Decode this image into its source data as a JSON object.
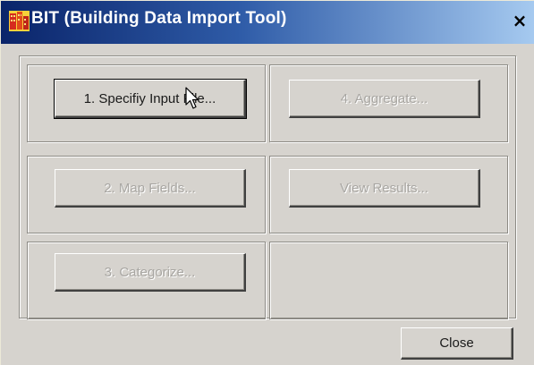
{
  "window": {
    "title": "BIT (Building Data Import Tool)",
    "close_glyph": "×",
    "app_icon": "bit-app-icon",
    "titlebar_colors": [
      "#0a246a",
      "#a6caf0"
    ]
  },
  "buttons": {
    "specify_input": {
      "label": "1. Specifiy Input File...",
      "enabled": true
    },
    "aggregate": {
      "label": "4. Aggregate...",
      "enabled": false
    },
    "map_fields": {
      "label": "2. Map Fields...",
      "enabled": false
    },
    "view_results": {
      "label": "View Results...",
      "enabled": false
    },
    "categorize": {
      "label": "3. Categorize...",
      "enabled": false
    },
    "close": {
      "label": "Close",
      "enabled": true
    }
  },
  "cursor": {
    "icon": "arrow-pointer-icon"
  }
}
